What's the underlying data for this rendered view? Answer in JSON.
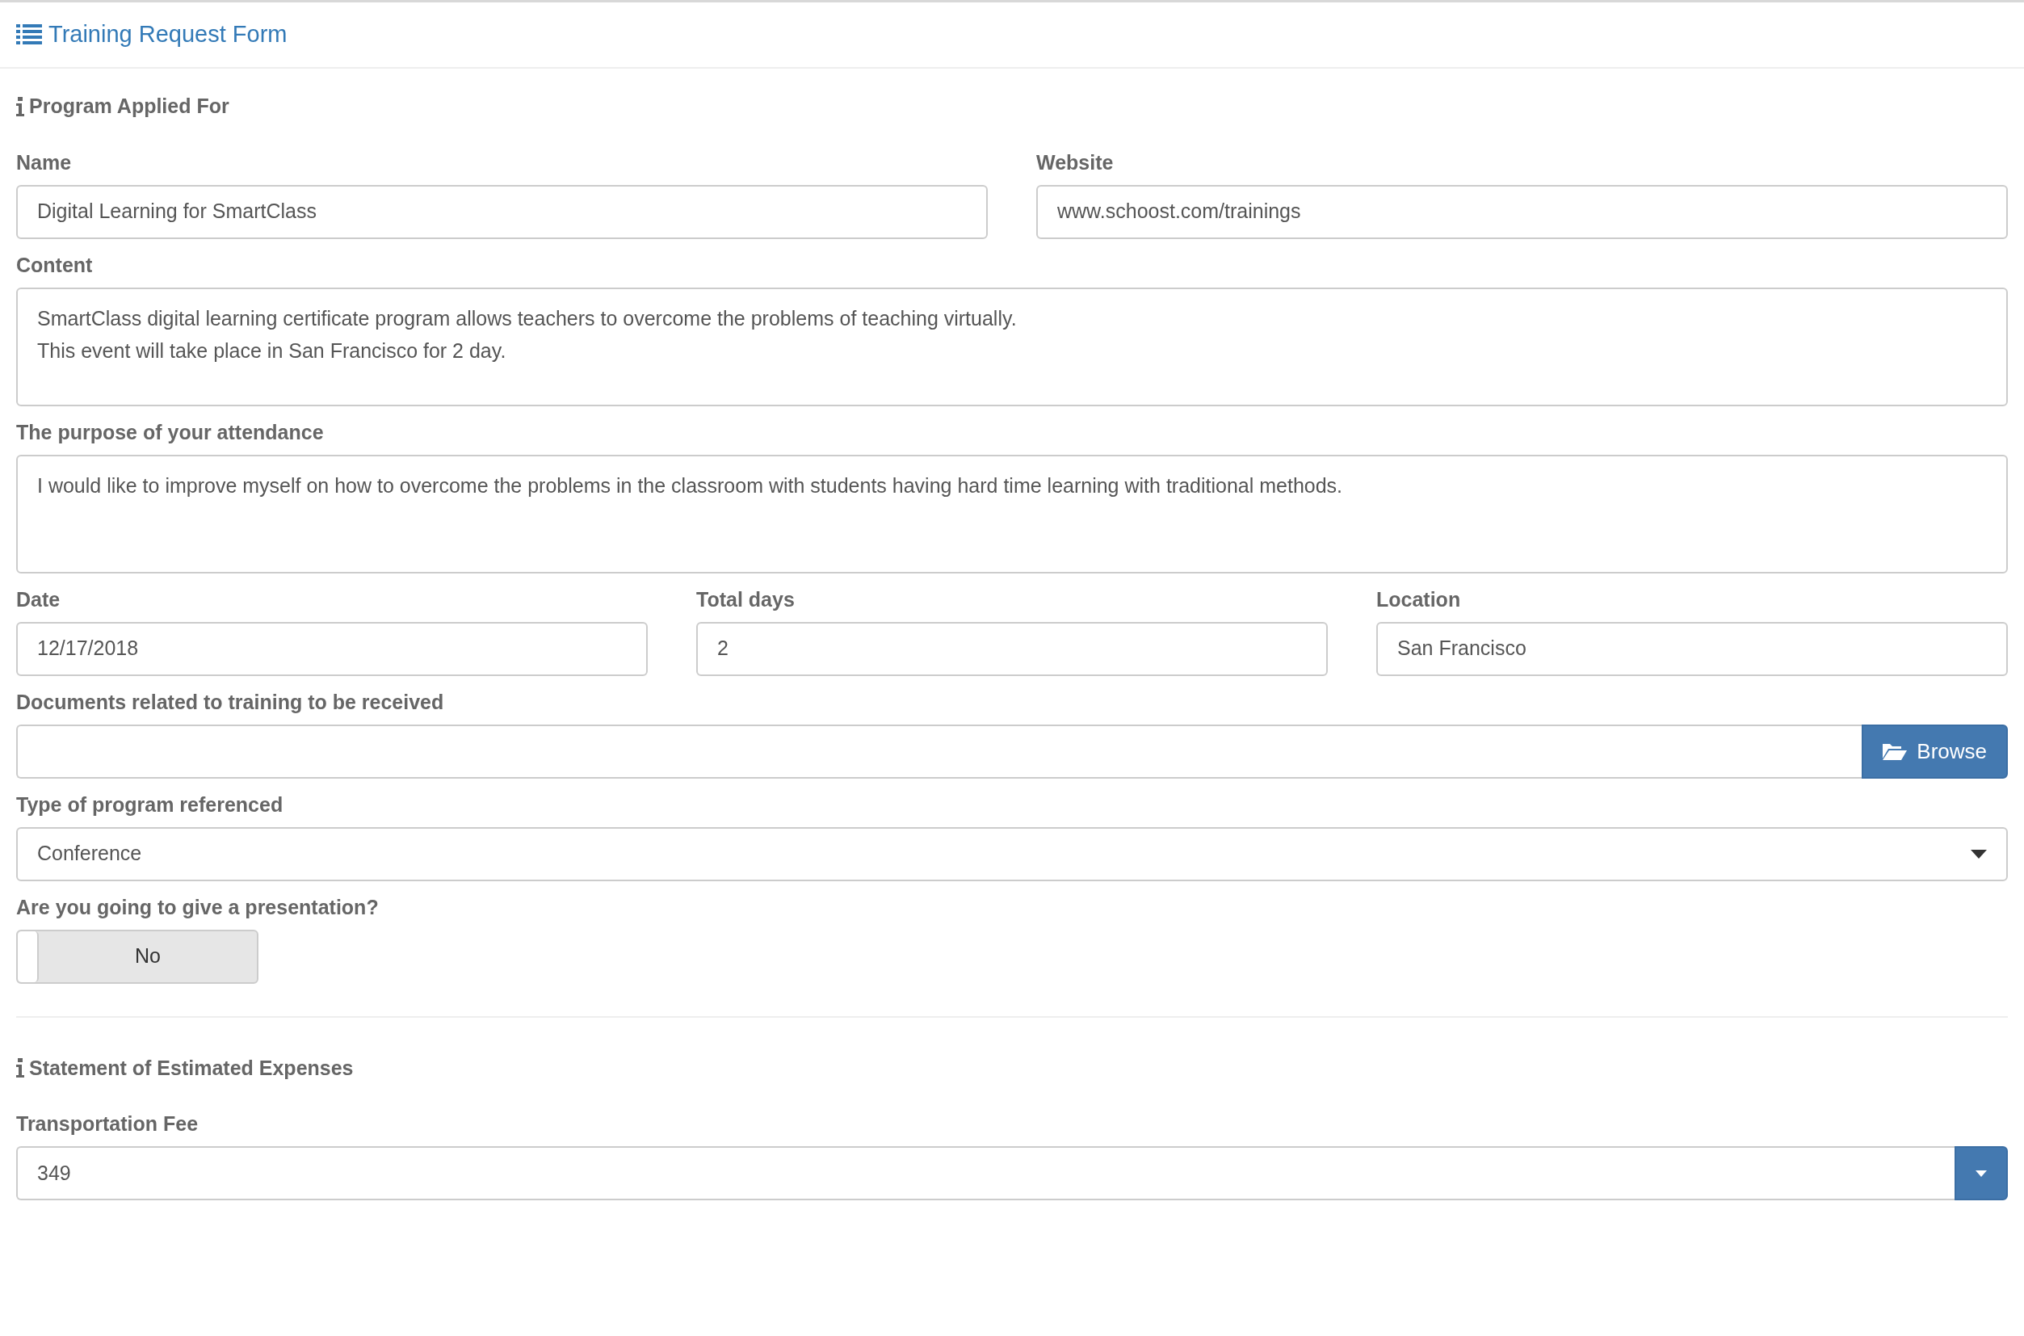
{
  "header": {
    "title": "Training Request Form"
  },
  "sections": [
    {
      "title": "Program Applied For",
      "rows": [
        [
          {
            "kind": "text",
            "label": "Name",
            "value": "Digital Learning for SmartClass"
          },
          {
            "kind": "text",
            "label": "Website",
            "value": "www.schoost.com/trainings"
          }
        ],
        [
          {
            "kind": "textarea",
            "label": "Content",
            "value": "SmartClass digital learning certificate program allows teachers to overcome the problems of teaching virtually.\nThis event will take place in San Francisco for 2 day."
          }
        ],
        [
          {
            "kind": "textarea",
            "label": "The purpose of your attendance",
            "value": "I would like to improve myself on how to overcome the problems in the classroom with students having hard time learning with traditional methods."
          }
        ],
        [
          {
            "kind": "text",
            "label": "Date",
            "value": "12/17/2018"
          },
          {
            "kind": "text",
            "label": "Total days",
            "value": "2"
          },
          {
            "kind": "text",
            "label": "Location",
            "value": "San Francisco"
          }
        ],
        [
          {
            "kind": "file",
            "label": "Documents related to training to be received",
            "button": "Browse"
          }
        ],
        [
          {
            "kind": "select",
            "label": "Type of program referenced",
            "value": "Conference"
          }
        ],
        [
          {
            "kind": "toggle",
            "label": "Are you going to give a presentation?",
            "on": false,
            "text": "No"
          }
        ]
      ]
    },
    {
      "title": "Statement of Estimated Expenses",
      "rows": [
        [
          {
            "kind": "combo",
            "label": "Transportation Fee",
            "value": "349"
          }
        ]
      ]
    }
  ]
}
